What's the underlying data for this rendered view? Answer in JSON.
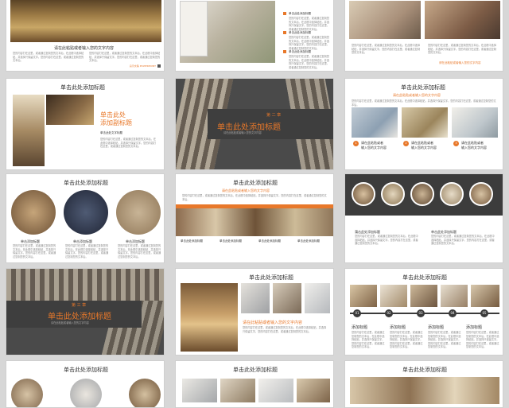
{
  "placeholder_title": "单击此处添加标题",
  "paste_text": "请在此粘贴或者输入您的文字内容",
  "paste_text_2": "请在此粘贴或者输入您的文字内容",
  "body_text": "您的内容打在这里，或者通过复制您的文本后，在此框中选择粘贴，并选择只保留文字。您的内容打在这里，或者通过复制您的文本后。",
  "logo_text": "演示文稿 POWERPOINT",
  "s2_items": [
    "单击此处添加标题",
    "单击此处添加标题",
    "单击此处添加标题"
  ],
  "s4_title_1": "单击此处",
  "s4_title_2": "添加副标题",
  "s4_sub": "单击此处文字标题",
  "chapter2_label": "第 二 章",
  "chapter2_title": "单击此处添加标题",
  "chapter3_label": "第 三 章",
  "chapter3_title": "单击此处添加标题",
  "s6_captions": [
    "请在此粘贴或者\n输入您的文字内容",
    "请在此粘贴或者\n输入您的文字内容",
    "请在此粘贴或者\n输入您的文字内容"
  ],
  "s6_nums": [
    "1",
    "2",
    "3"
  ],
  "s7_labels": [
    "单击添加标题",
    "单击添加标题",
    "单击添加标题"
  ],
  "s8_labels": [
    "单击此处添加标题",
    "单击此处添加标题",
    "单击此处添加标题",
    "单击此处添加标题"
  ],
  "s9_items": [
    "蒲击此处添加标题",
    "单击此处添加标题"
  ],
  "s12_labels": [
    "添加标题",
    "添加标题",
    "添加标题",
    "添加标题"
  ],
  "s12_nums": [
    "01",
    "02",
    "03",
    "04",
    "05"
  ],
  "colors": {
    "accent": "#e8782a",
    "dark": "#4a4a4a"
  }
}
